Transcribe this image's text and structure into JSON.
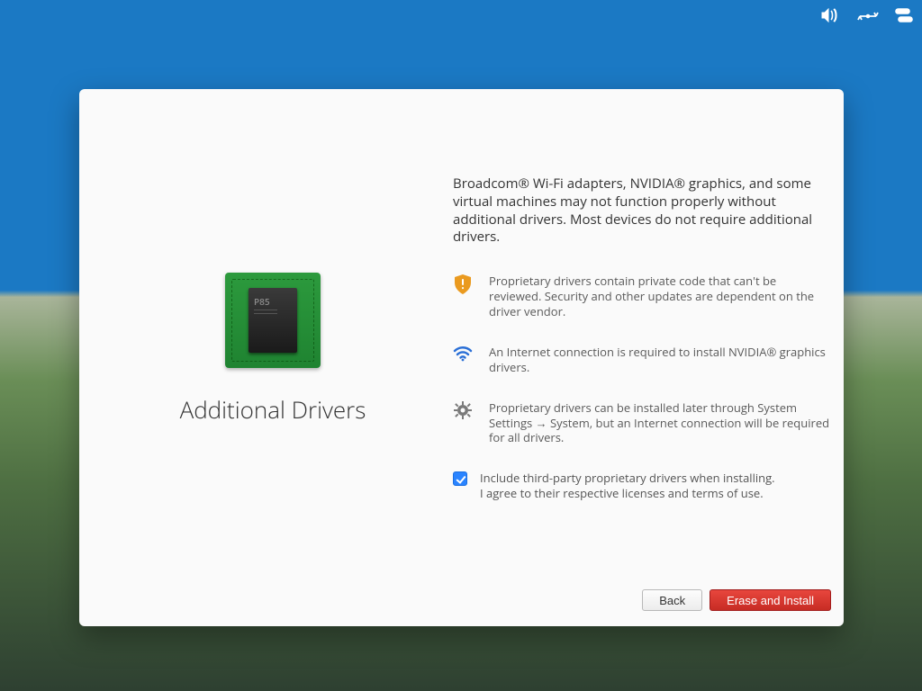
{
  "topbar": {
    "sound": "sound-icon",
    "network": "network-icon",
    "battery": "battery-icon"
  },
  "page": {
    "title": "Additional Drivers",
    "intro": "Broadcom® Wi-Fi adapters, NVIDIA® graphics, and some virtual machines may not function properly without additional drivers. Most devices do not require additional drivers.",
    "notes": [
      "Proprietary drivers contain private code that can't be reviewed. Security and other updates are dependent on the driver vendor.",
      "An Internet connection is required to install NVIDIA® graphics drivers.",
      "Proprietary drivers can be installed later through System Settings → System, but an Internet connection will be required for all drivers."
    ],
    "checkbox": {
      "checked": true,
      "line1": "Include third-party proprietary drivers when installing.",
      "line2": "I agree to their respective licenses and terms of use."
    }
  },
  "buttons": {
    "back": "Back",
    "erase": "Erase and Install"
  }
}
